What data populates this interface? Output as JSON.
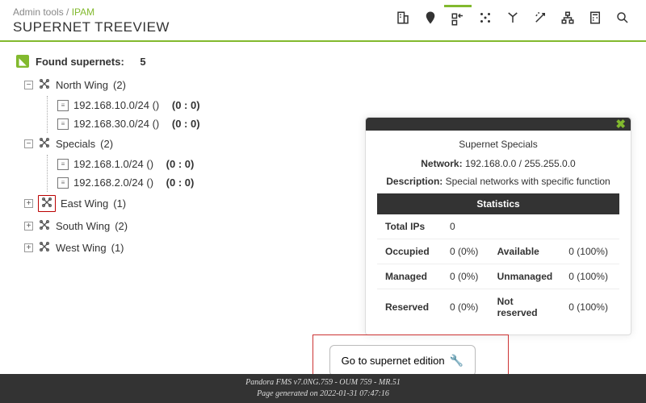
{
  "header": {
    "breadcrumb_root": "Admin tools",
    "breadcrumb_sep": " / ",
    "breadcrumb_current": "IPAM",
    "title": "SUPERNET TREEVIEW"
  },
  "found": {
    "label": "Found supernets:",
    "count": "5"
  },
  "tree": {
    "north": {
      "label": "North Wing",
      "count": "(2)",
      "children": [
        {
          "label": "192.168.10.0/24 ()",
          "stat": "(0 : 0)"
        },
        {
          "label": "192.168.30.0/24 ()",
          "stat": "(0 : 0)"
        }
      ]
    },
    "specials": {
      "label": "Specials",
      "count": "(2)",
      "children": [
        {
          "label": "192.168.1.0/24 ()",
          "stat": "(0 : 0)"
        },
        {
          "label": "192.168.2.0/24 ()",
          "stat": "(0 : 0)"
        }
      ]
    },
    "east": {
      "label": "East Wing",
      "count": "(1)"
    },
    "south": {
      "label": "South Wing",
      "count": "(2)"
    },
    "west": {
      "label": "West Wing",
      "count": "(1)"
    }
  },
  "panel": {
    "title": "Supernet Specials",
    "network_label": "Network:",
    "network_value": "192.168.0.0 / 255.255.0.0",
    "desc_label": "Description:",
    "desc_value": "Special networks with specific function",
    "stats_header": "Statistics",
    "rows": {
      "total_label": "Total IPs",
      "total_value": "0",
      "occ_label": "Occupied",
      "occ_value": "0 (0%)",
      "avail_label": "Available",
      "avail_value": "0 (100%)",
      "man_label": "Managed",
      "man_value": "0 (0%)",
      "unman_label": "Unmanaged",
      "unman_value": "0 (100%)",
      "res_label": "Reserved",
      "res_value": "0 (0%)",
      "notres_label": "Not reserved",
      "notres_value": "0 (100%)"
    }
  },
  "goto_label": "Go to supernet edition",
  "footer": {
    "line1": "Pandora FMS v7.0NG.759 - OUM 759 - MR.51",
    "line2": "Page generated on 2022-01-31 07:47:16"
  },
  "expander_minus": "−",
  "expander_plus": "+"
}
